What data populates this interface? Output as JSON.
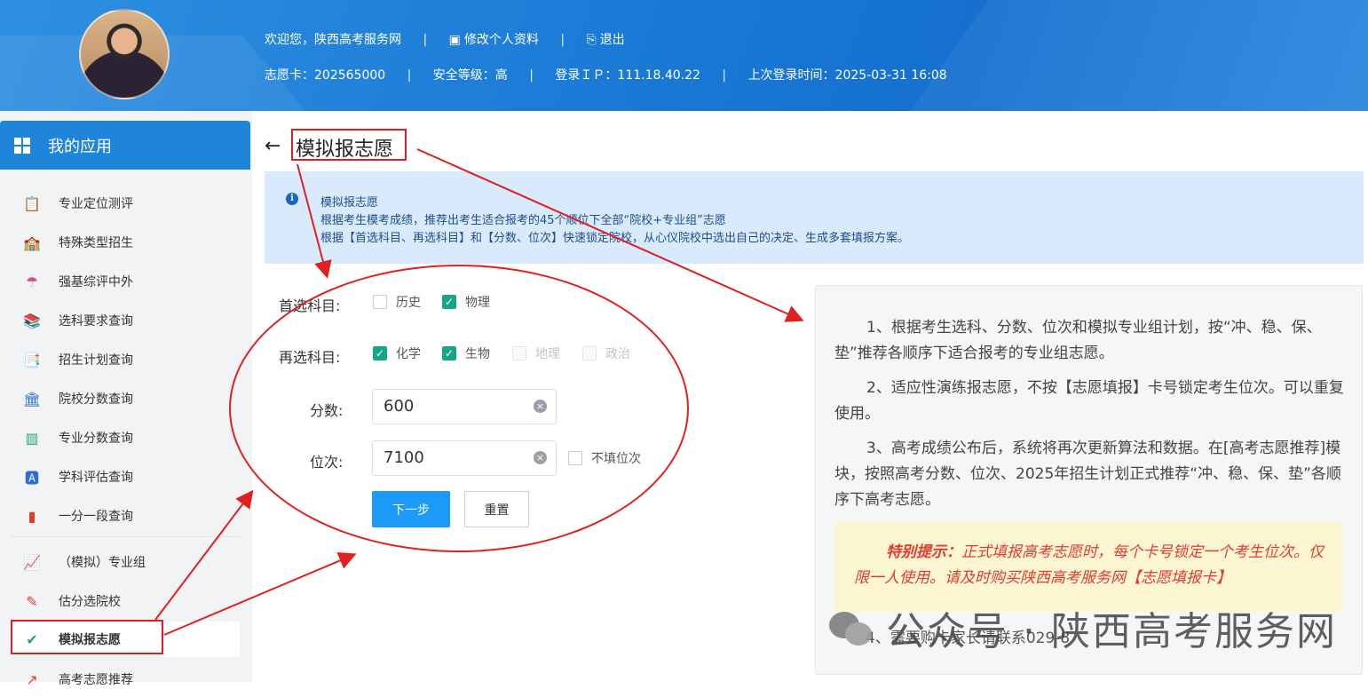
{
  "header": {
    "welcome": "欢迎您，陕西高考服务网",
    "edit_profile": "修改个人资料",
    "logout": "退出",
    "card": "志愿卡：202565000",
    "security": "安全等级：高",
    "login_ip": "登录ＩＰ：111.18.40.22",
    "last_login": "上次登录时间：2025-03-31 16:08"
  },
  "sidebar": {
    "title": "我的应用",
    "items": [
      {
        "label": "专业定位测评",
        "icon": "clipboard-icon",
        "color": "#e8664b"
      },
      {
        "label": "特殊类型招生",
        "icon": "school-icon",
        "color": "#2b8fe0"
      },
      {
        "label": "强基综评中外",
        "icon": "umbrella-icon",
        "color": "#e44a8a"
      },
      {
        "label": "选科要求查询",
        "icon": "books-icon",
        "color": "#5a6fd6"
      },
      {
        "label": "招生计划查询",
        "icon": "plan-icon",
        "color": "#f07a3a"
      },
      {
        "label": "院校分数查询",
        "icon": "bank-icon",
        "color": "#2b6fd6"
      },
      {
        "label": "专业分数查询",
        "icon": "bookshelf-icon",
        "color": "#2aa56a"
      },
      {
        "label": "学科评估查询",
        "icon": "grade-icon",
        "color": "#2b6fd6"
      },
      {
        "label": "一分一段查询",
        "icon": "bar-chart-icon",
        "color": "#e23b2e"
      },
      {
        "label": "（模拟）专业组",
        "icon": "line-chart-icon",
        "color": "#2b6fd6"
      },
      {
        "label": "估分选院校",
        "icon": "pencil-icon",
        "color": "#e23b2e"
      },
      {
        "label": "模拟报志愿",
        "icon": "edit-check-icon",
        "color": "#2aa56a"
      },
      {
        "label": "高考志愿推荐",
        "icon": "trend-icon",
        "color": "#e23b2e"
      }
    ]
  },
  "page": {
    "title": "模拟报志愿",
    "info_lines": [
      "模拟报志愿",
      "根据考生模考成绩，推荐出考生适合报考的45个顺位下全部“院校+专业组”志愿",
      "根据【首选科目、再选科目】和【分数、位次】快速锁定院校，从心仪院校中选出自己的决定、生成多套填报方案。"
    ]
  },
  "form": {
    "first_subject_label": "首选科目:",
    "first_options": [
      {
        "label": "历史",
        "checked": false
      },
      {
        "label": "物理",
        "checked": true
      }
    ],
    "second_subject_label": "再选科目:",
    "second_options": [
      {
        "label": "化学",
        "checked": true,
        "disabled": false
      },
      {
        "label": "生物",
        "checked": true,
        "disabled": false
      },
      {
        "label": "地理",
        "checked": false,
        "disabled": true
      },
      {
        "label": "政治",
        "checked": false,
        "disabled": true
      }
    ],
    "score_label": "分数:",
    "score_value": "600",
    "rank_label": "位次:",
    "rank_value": "7100",
    "no_rank_label": "不填位次",
    "next_button": "下一步",
    "reset_button": "重置"
  },
  "notes": {
    "p1": "1、根据考生选科、分数、位次和模拟专业组计划，按“冲、稳、保、垫”推荐各顺序下适合报考的专业组志愿。",
    "p2": "2、适应性演练报志愿，不按【志愿填报】卡号锁定考生位次。可以重复使用。",
    "p3": "3、高考成绩公布后，系统将再次更新算法和数据。在[高考志愿推荐]模块，按照高考分数、位次、2025年招生计划正式推荐“冲、稳、保、垫”各顺序下高考志愿。",
    "tip_label": "特别提示：",
    "tip_text": "正式填报高考志愿时，每个卡号锁定一个考生位次。仅限一人使用。请及时购买陕西高考服务网【志愿填报卡】",
    "p4": "4、需要购卡家长请联系029-8"
  },
  "watermark": "公众号 · 陕西高考服务网",
  "colors": {
    "header": "#1a7ad6",
    "accent": "#1b9af7",
    "checked": "#17a58a",
    "annotation": "#e02020"
  }
}
